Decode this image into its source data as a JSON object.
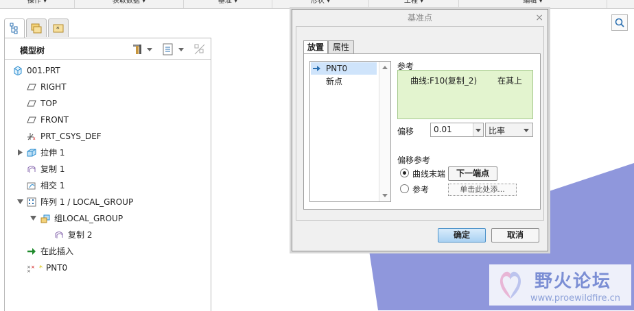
{
  "ribbon": {
    "groups": [
      "操作 ▾",
      "获取数据 ▾",
      "基准 ▾",
      "形状 ▾",
      "工程 ▾",
      "编辑 ▾"
    ]
  },
  "model_tree": {
    "title": "模型树",
    "items": [
      {
        "label": "001.PRT",
        "icon": "part-icon"
      },
      {
        "label": "RIGHT",
        "icon": "plane-icon"
      },
      {
        "label": "TOP",
        "icon": "plane-icon"
      },
      {
        "label": "FRONT",
        "icon": "plane-icon"
      },
      {
        "label": "PRT_CSYS_DEF",
        "icon": "csys-icon"
      },
      {
        "label": "拉伸 1",
        "icon": "extrude-icon"
      },
      {
        "label": "复制 1",
        "icon": "copy-icon"
      },
      {
        "label": "相交 1",
        "icon": "intersect-icon"
      },
      {
        "label": "阵列 1 / LOCAL_GROUP",
        "icon": "pattern-icon"
      },
      {
        "label": "组LOCAL_GROUP",
        "icon": "group-icon"
      },
      {
        "label": "复制 2",
        "icon": "copy-icon"
      },
      {
        "label": "在此插入",
        "icon": "insert-arrow-icon"
      },
      {
        "label": "PNT0",
        "icon": "datum-point-icon"
      }
    ]
  },
  "dialog": {
    "title": "基准点",
    "close": "×",
    "tabs": [
      "放置",
      "属性"
    ],
    "points": [
      "PNT0",
      "新点"
    ],
    "reference_label": "参考",
    "reference_value": "曲线:F10(复制_2)",
    "reference_constraint": "在其上",
    "offset_label": "偏移",
    "offset_value": "0.01",
    "offset_type": "比率",
    "offset_ref_label": "偏移参考",
    "radio_curve_end": "曲线末端",
    "next_endpoint": "下一端点",
    "radio_reference": "参考",
    "click_to_add": "单击此处添...",
    "ok": "确定",
    "cancel": "取消"
  },
  "watermark": {
    "title": "野火论坛",
    "url": "www.proewildfire.cn"
  },
  "colors": {
    "surface": "#8f97dc",
    "selection": "#cfe4fb",
    "reference_box": "#e3f4cf"
  }
}
